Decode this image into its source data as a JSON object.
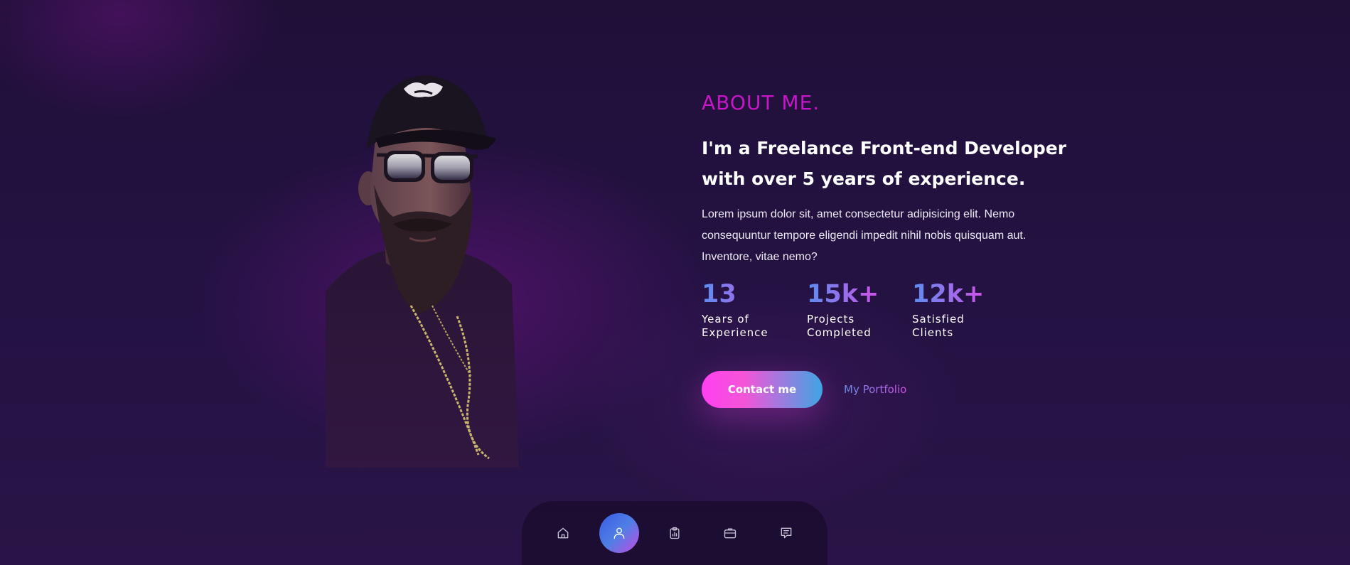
{
  "about": {
    "heading": "ABOUT ME.",
    "subheading": "I'm a Freelance Front-end Developer with over 5 years of experience.",
    "description": "Lorem ipsum dolor sit, amet consectetur adipisicing elit. Nemo consequuntur tempore eligendi impedit nihil nobis quisquam aut. Inventore, vitae nemo?"
  },
  "stats": [
    {
      "number": "13",
      "label": "Years of Experience"
    },
    {
      "number": "15k+",
      "label": "Projects Completed"
    },
    {
      "number": "12k+",
      "label": "Satisfied Clients"
    }
  ],
  "actions": {
    "contact_label": "Contact me",
    "portfolio_label": "My Portfolio"
  },
  "nav": {
    "items": [
      {
        "icon": "home-icon",
        "active": false
      },
      {
        "icon": "user-icon",
        "active": true
      },
      {
        "icon": "clipboard-chart-icon",
        "active": false
      },
      {
        "icon": "briefcase-icon",
        "active": false
      },
      {
        "icon": "message-icon",
        "active": false
      }
    ]
  },
  "colors": {
    "accent_magenta": "#c716c8",
    "gradient_pink": "#ff3ff0",
    "gradient_blue": "#3fa5e4",
    "background": "#241243"
  }
}
